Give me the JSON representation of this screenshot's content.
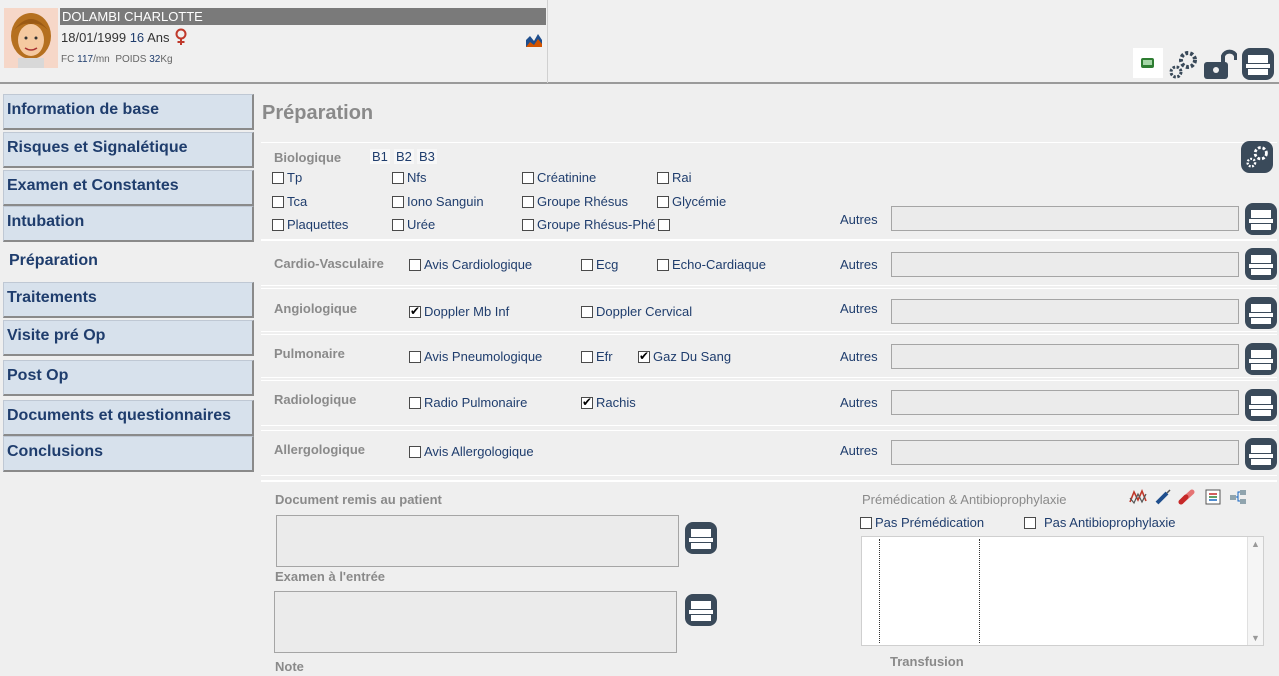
{
  "patient": {
    "name": "DOLAMBI  CHARLOTTE",
    "dob": "18/01/1999",
    "age_value": "16",
    "age_unit": "Ans",
    "fc_label": "FC",
    "fc_value": "117",
    "fc_unit": "/mn",
    "poids_label": "POIDS",
    "poids_value": "32",
    "poids_unit": "Kg"
  },
  "sidebar": {
    "items": [
      {
        "label": "Information de base"
      },
      {
        "label": "Risques et Signalétique"
      },
      {
        "label": "Examen et Constantes"
      },
      {
        "label": "Intubation"
      },
      {
        "label": "Préparation"
      },
      {
        "label": "Traitements"
      },
      {
        "label": "Visite pré Op"
      },
      {
        "label": "Post Op"
      },
      {
        "label": "Documents et questionnaires"
      },
      {
        "label": "Conclusions"
      }
    ],
    "active_index": 4
  },
  "main": {
    "title": "Préparation",
    "autres_label": "Autres",
    "biologique": {
      "label": "Biologique",
      "tags": [
        "B1",
        "B2",
        "B3"
      ],
      "checks": [
        {
          "label": "Tp",
          "checked": false
        },
        {
          "label": "Nfs",
          "checked": false
        },
        {
          "label": "Créatinine",
          "checked": false
        },
        {
          "label": "Rai",
          "checked": false
        },
        {
          "label": "Tca",
          "checked": false
        },
        {
          "label": "Iono Sanguin",
          "checked": false
        },
        {
          "label": "Groupe Rhésus",
          "checked": false
        },
        {
          "label": "Glycémie",
          "checked": false
        },
        {
          "label": "Plaquettes",
          "checked": false
        },
        {
          "label": "Urée",
          "checked": false
        },
        {
          "label": "Groupe Rhésus-Phé",
          "checked": false
        },
        {
          "label": "",
          "checked": false
        }
      ]
    },
    "cardio": {
      "label": "Cardio-Vasculaire",
      "checks": [
        {
          "label": "Avis Cardiologique",
          "checked": false
        },
        {
          "label": "Ecg",
          "checked": false
        },
        {
          "label": "Echo-Cardiaque",
          "checked": false
        }
      ]
    },
    "angio": {
      "label": "Angiologique",
      "checks": [
        {
          "label": "Doppler Mb Inf",
          "checked": true
        },
        {
          "label": "Doppler Cervical",
          "checked": false
        }
      ]
    },
    "pulmo": {
      "label": "Pulmonaire",
      "checks": [
        {
          "label": "Avis Pneumologique",
          "checked": false
        },
        {
          "label": "Efr",
          "checked": false
        },
        {
          "label": "Gaz Du Sang",
          "checked": true
        }
      ]
    },
    "radio": {
      "label": "Radiologique",
      "checks": [
        {
          "label": "Radio Pulmonaire",
          "checked": false
        },
        {
          "label": "Rachis",
          "checked": true
        }
      ]
    },
    "allergo": {
      "label": "Allergologique",
      "checks": [
        {
          "label": "Avis Allergologique",
          "checked": false
        }
      ]
    },
    "lower": {
      "document_label": "Document remis au patient",
      "examen_label": "Examen à l'entrée",
      "note_label": "Note",
      "premed_title": "Prémédication & Antibioprophylaxie",
      "pas_premed": {
        "label": "Pas Prémédication",
        "checked": false
      },
      "pas_antibio": {
        "label": "Pas Antibioprophylaxie",
        "checked": false
      },
      "transfusion_label": "Transfusion"
    }
  }
}
